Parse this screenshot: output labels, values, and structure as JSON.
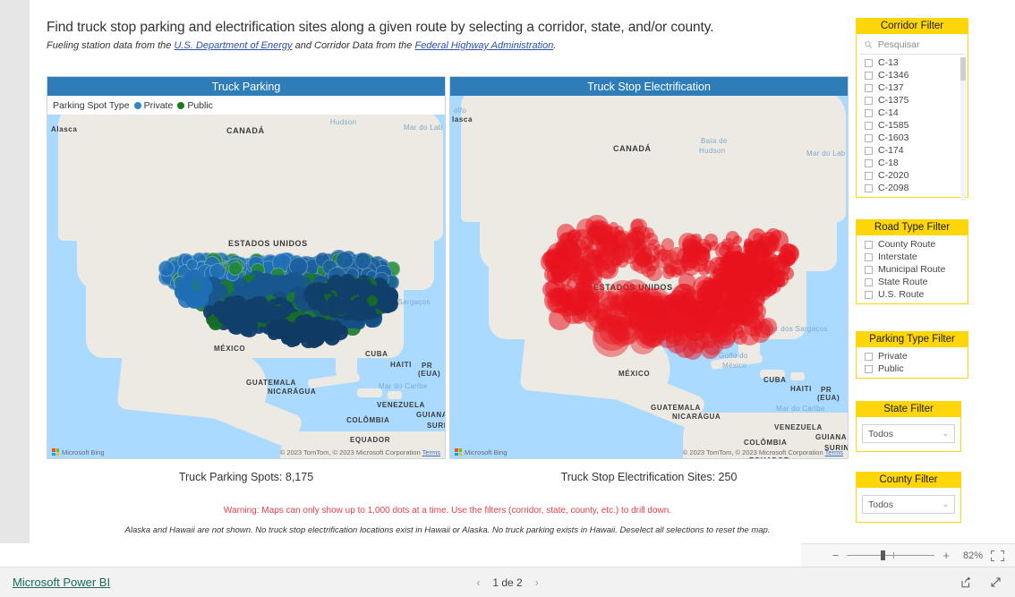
{
  "header": {
    "title": "Find truck stop parking and electrification sites along a given route by selecting a corridor, state, and/or county.",
    "sub_pre": "Fueling station data from the ",
    "sub_link1": "U.S. Department of Energy",
    "sub_mid": " and Corridor Data from the ",
    "sub_link2": "Federal Highway Administration",
    "sub_post": "."
  },
  "maps": {
    "parking": {
      "title": "Truck Parking",
      "legend_title": "Parking Spot Type",
      "legend": [
        {
          "label": "Private",
          "color": "#2e86c8"
        },
        {
          "label": "Public",
          "color": "#1a7a1a"
        }
      ],
      "attribution": "© 2023 TomTom, © 2023 Microsoft Corporation",
      "terms": "Terms",
      "provider": "Microsoft Bing"
    },
    "electrification": {
      "title": "Truck Stop Electrification",
      "dot_color": "#e8131d",
      "attribution": "© 2023 TomTom, © 2023 Microsoft Corporation",
      "terms": "Terms",
      "provider": "Microsoft Bing"
    },
    "labels": [
      "CANADÁ",
      "ESTADOS UNIDOS",
      "MÉXICO",
      "CUBA",
      "HAITI",
      "PR (EUA)",
      "GUATEMALA",
      "NICARÁGUA",
      "VENEZUELA",
      "GUIANA",
      "COLÔMBIA",
      "SURINAME",
      "EQUADOR",
      "Hudson",
      "Mar do Lab",
      "Mar dos Sargaços",
      "Golfo do México",
      "Mar do Caribe",
      "Alasca"
    ]
  },
  "metrics": {
    "parking": "Truck Parking Spots: 8,175",
    "electrification": "Truck Stop Electrification Sites: 250"
  },
  "warning": "Warning: Maps can only show up to 1,000 dots at a time. Use the filters (corridor, state, county, etc.) to drill down.",
  "footnote": "Alaska and Hawaii are not shown. No truck stop electrification locations exist in Hawaii or Alaska. No truck parking exists in Hawaii. Deselect all selections to reset the map.",
  "slicers": {
    "corridor": {
      "title": "Corridor Filter",
      "search_placeholder": "Pesquisar",
      "search_value": "",
      "items": [
        "C-13",
        "C-1346",
        "C-137",
        "C-1375",
        "C-14",
        "C-1585",
        "C-1603",
        "C-174",
        "C-18",
        "C-2020",
        "C-2098"
      ]
    },
    "road_type": {
      "title": "Road Type Filter",
      "items": [
        "County Route",
        "Interstate",
        "Municipal Route",
        "State Route",
        "U.S. Route"
      ]
    },
    "parking_type": {
      "title": "Parking Type Filter",
      "items": [
        "Private",
        "Public"
      ]
    },
    "state": {
      "title": "State Filter",
      "value": "Todos"
    },
    "county": {
      "title": "County Filter",
      "value": "Todos"
    }
  },
  "zoombar": {
    "minus": "−",
    "plus": "+",
    "percent": "82%"
  },
  "footer": {
    "brand": "Microsoft Power BI",
    "page": "1 de 2",
    "prev": "‹",
    "next": "›"
  },
  "theme": {
    "slicer_header_bg": "#ffd60a",
    "map_header_bg": "#2e7cb8",
    "warning_color": "#e8404a",
    "link_color": "#2a4fae",
    "brand_link_color": "#1b6b5a"
  }
}
